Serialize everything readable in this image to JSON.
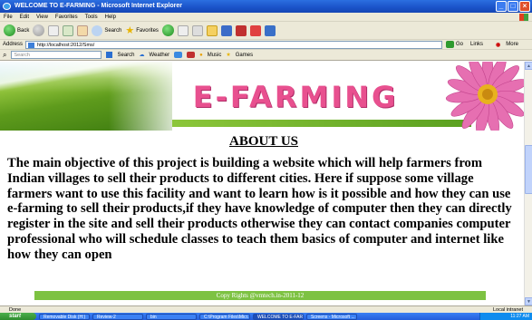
{
  "window": {
    "title": "WELCOME TO E-FARMING - Microsoft Internet Explorer",
    "controls": [
      "_",
      "□",
      "×"
    ]
  },
  "menu": [
    "File",
    "Edit",
    "View",
    "Favorites",
    "Tools",
    "Help"
  ],
  "toolbar": {
    "back_label": "Back",
    "search_label": "Search",
    "favorites_label": "Favorites"
  },
  "address": {
    "label": "Address",
    "url": "http://localhost:2012/Sms/",
    "go_label": "Go",
    "links_label": "Links",
    "more_label": "More"
  },
  "searchbar": {
    "placeholder": "Search",
    "search_label": "Search",
    "weather_label": "Weather",
    "music_label": "Music",
    "games_label": "Games"
  },
  "page": {
    "banner_title": "E-FARMING",
    "about_title": "ABOUT US",
    "about_text": "The main objective of this project is building a website which will help farmers from Indian villages to sell their products to different cities. Here if suppose some village farmers want to use this facility and want to learn how is it possible and how they can use e-farming to sell their products,if they have knowledge of computer then they can directly register in the site and sell their products otherwise they can contact companies computer professional who will schedule classes to teach them basics of computer and internet like how they can open",
    "footer": "Copy Rights @vmtech.in-2011-12"
  },
  "status": {
    "left": "Done",
    "zone": "Local intranet"
  },
  "taskbar": {
    "start": "start",
    "tasks": [
      "Removable Disk (H:)",
      "Review-2",
      "bin",
      "C:\\Program Files\\Micr...",
      "WELCOME TO E-FAR...",
      "Screens - Microsoft ..."
    ],
    "time": "11:27 AM"
  },
  "colors": {
    "title_pink": "#e8508f",
    "footer_green": "#7dc242",
    "xp_blue": "#245edb"
  }
}
